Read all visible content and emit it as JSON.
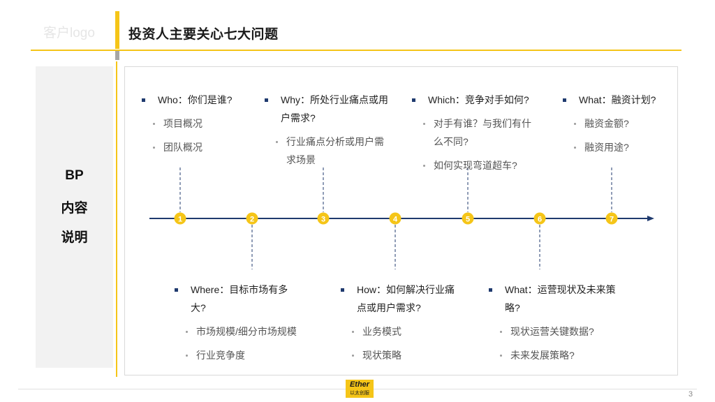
{
  "header": {
    "logo_text": "客户logo",
    "title": "投资人主要关心七大问题"
  },
  "sidebar": {
    "lines": [
      "BP",
      "内容",
      "说明"
    ]
  },
  "timeline": {
    "numbers": [
      "1",
      "2",
      "3",
      "4",
      "5",
      "6",
      "7"
    ]
  },
  "groups": [
    {
      "id": "who",
      "head": [
        "Who：你们是谁?"
      ],
      "items": [
        [
          "项目概况"
        ],
        [
          "团队概况"
        ]
      ]
    },
    {
      "id": "why",
      "head": [
        "Why：所处行业痛点或用",
        "户需求?"
      ],
      "items": [
        [
          "行业痛点分析或用户需",
          "求场景"
        ]
      ]
    },
    {
      "id": "which",
      "head": [
        "Which：竞争对手如何?"
      ],
      "items": [
        [
          "对手有谁？与我们有什",
          "么不同?"
        ],
        [
          "如何实现弯道超车?"
        ]
      ]
    },
    {
      "id": "what-fin",
      "head": [
        "What：融资计划?"
      ],
      "items": [
        [
          "融资金额?"
        ],
        [
          "融资用途?"
        ]
      ]
    },
    {
      "id": "where",
      "head": [
        "Where：目标市场有多",
        "大?"
      ],
      "items": [
        [
          "市场规模/细分市场规模"
        ],
        [
          "行业竞争度"
        ]
      ]
    },
    {
      "id": "how",
      "head": [
        "How：如何解决行业痛",
        "点或用户需求?"
      ],
      "items": [
        [
          "业务模式"
        ],
        [
          "现状策略"
        ]
      ]
    },
    {
      "id": "what-ops",
      "head": [
        "What：运营现状及未来策",
        "略?"
      ],
      "items": [
        [
          "现状运营关键数据?"
        ],
        [
          "未来发展策略?"
        ]
      ]
    }
  ],
  "footer": {
    "logo_line1": "Ether",
    "logo_line2": "以太创服",
    "page_number": "3"
  },
  "colors": {
    "accent": "#f5c518",
    "navy": "#1f3a6e"
  }
}
